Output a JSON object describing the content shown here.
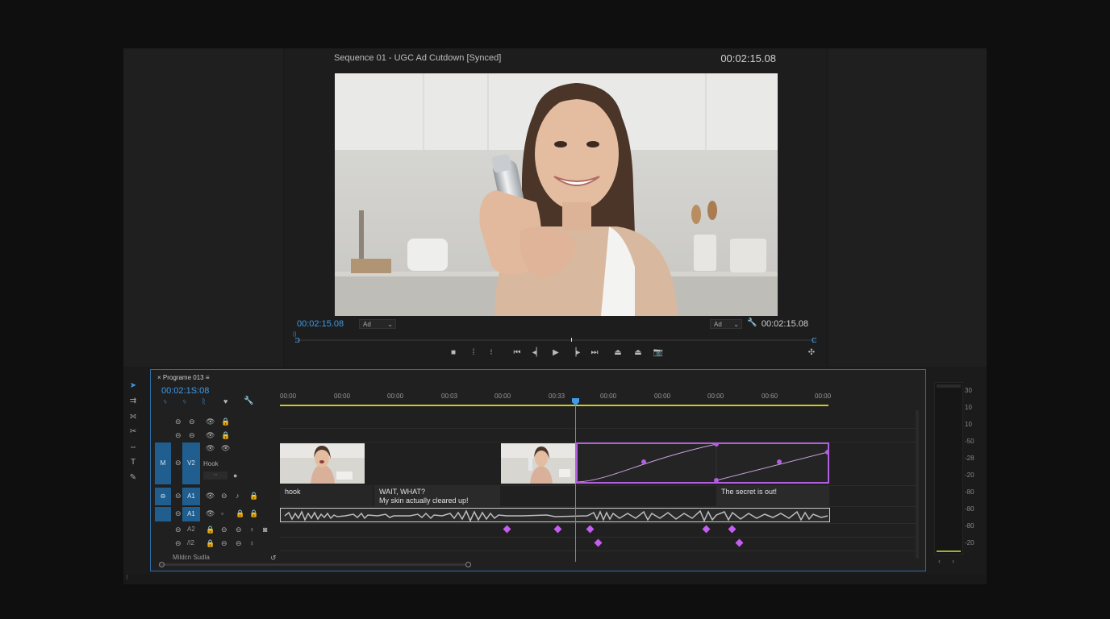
{
  "monitor": {
    "sequence_title": "Sequence 01 - UGC Ad Cutdown [Synced]",
    "timecode_top": "00:02:15.08",
    "timecode_playhead": "00:02:15.08",
    "timecode_duration": "00:02:15.08",
    "fit_left": "Ad",
    "fit_right": "Ad",
    "video_description": "woman-holding-serum-bottle"
  },
  "transport": {
    "buttons": [
      "stop-icon",
      "mark-in-icon",
      "mark-out-icon",
      "go-to-in-icon",
      "step-back-icon",
      "play-icon",
      "step-forward-icon",
      "go-to-out-icon",
      "lift-icon",
      "extract-icon",
      "export-frame-icon",
      "settings-icon"
    ]
  },
  "timeline": {
    "tab_label": "Programe 013",
    "timecode": "00:02:1S:08",
    "ruler_ticks": [
      "00:00",
      "00:00",
      "00:00",
      "00:03",
      "00:00",
      "00:33",
      "00:00",
      "00:00",
      "00:00",
      "00:60",
      "00:00"
    ],
    "tracks": {
      "v2_label": "V2",
      "v2_name": "Hook",
      "v_target": "M",
      "a1_label": "A1",
      "a1b_label": "A1",
      "a2_label": "A2",
      "a3_label": "/I2",
      "mix_label": "Mildcn Sudla"
    },
    "captions": [
      {
        "text": "hook"
      },
      {
        "line1": "WAIT, WHAT?",
        "line2": "My skin actually cleared up!"
      },
      {
        "text": "The secret is out!"
      }
    ]
  },
  "meter": {
    "scale": [
      "30",
      "10",
      "10",
      "-50",
      "-28",
      "-20",
      "-80",
      "-80",
      "-80",
      "-20"
    ]
  },
  "colors": {
    "accent": "#3d9be9",
    "keyframe": "#c55df0",
    "selection": "#b35de0",
    "work_area": "#c9c92b"
  }
}
